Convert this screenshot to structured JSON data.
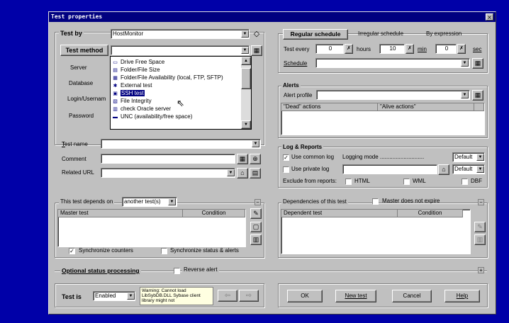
{
  "window": {
    "title": "Test properties",
    "close": "×"
  },
  "test_by": {
    "label": "Test by",
    "value": "HostMonitor"
  },
  "test_method": {
    "label": "Test method",
    "value": ""
  },
  "method_list": [
    {
      "label": "Drive Free Space",
      "icon": "drive-icon"
    },
    {
      "label": "Folder/File Size",
      "icon": "folder-icon"
    },
    {
      "label": "Folder/File Availability (local, FTP, SFTP)",
      "icon": "file-icon"
    },
    {
      "label": "External test",
      "icon": "external-icon"
    },
    {
      "label": "SSH test",
      "icon": "ssh-icon",
      "selected": true
    },
    {
      "label": "File Integrity",
      "icon": "integrity-icon"
    },
    {
      "label": "check Oracle server",
      "icon": "oracle-icon"
    },
    {
      "label": "UNC (availability/free space)",
      "icon": "unc-icon"
    }
  ],
  "left_params": {
    "server": "Server",
    "database": "Database",
    "login": "Login/Usernam",
    "password": "Password"
  },
  "test_name": {
    "label": "Test name"
  },
  "comment": {
    "label": "Comment"
  },
  "related_url": {
    "label": "Related URL"
  },
  "schedule_tabs": [
    "Regular schedule",
    "Irregular schedule",
    "By expression"
  ],
  "schedule": {
    "test_every": "Test every",
    "hours_value": "0",
    "hours": "hours",
    "min_value": "10",
    "min": "min",
    "sec_value": "0",
    "sec": "sec",
    "schedule_label": "Schedule"
  },
  "alerts": {
    "title": "Alerts",
    "profile_label": "Alert profile",
    "col_dead": "\"Dead\" actions",
    "col_alive": "\"Alive actions\""
  },
  "log": {
    "title": "Log & Reports",
    "use_common": "Use common log",
    "logging_mode": "Logging mode ............................",
    "common_mode": "Default",
    "use_private": "Use private log",
    "private_mode": "Default",
    "exclude": "Exclude from reports:",
    "html": "HTML",
    "wml": "WML",
    "dbf": "DBF"
  },
  "depends": {
    "label": "This test depends on",
    "value": "another test(s)",
    "col_master": "Master test",
    "col_condition": "Condition",
    "sync_counters": "Synchronize counters",
    "sync_status": "Synchronize status & alerts"
  },
  "dependencies": {
    "label": "Dependencies of this test",
    "master_not_expire": "Master does not expire",
    "col_dependent": "Dependent test",
    "col_condition": "Condition"
  },
  "optional": {
    "label": "Optional status processing",
    "reverse": "Reverse alert"
  },
  "footer": {
    "test_is": "Test is",
    "state": "Enabled",
    "warning": "Warning: Cannot load LibSybDB.DLL Sybase client library might not",
    "ok": "OK",
    "new_test": "New test",
    "cancel": "Cancel",
    "help": "Help"
  },
  "colors": {
    "desktop": "#0000a8",
    "titlebar": "#000080",
    "face": "#c0c0c0",
    "selection": "#000080",
    "warning_bg": "#ffffe1"
  }
}
